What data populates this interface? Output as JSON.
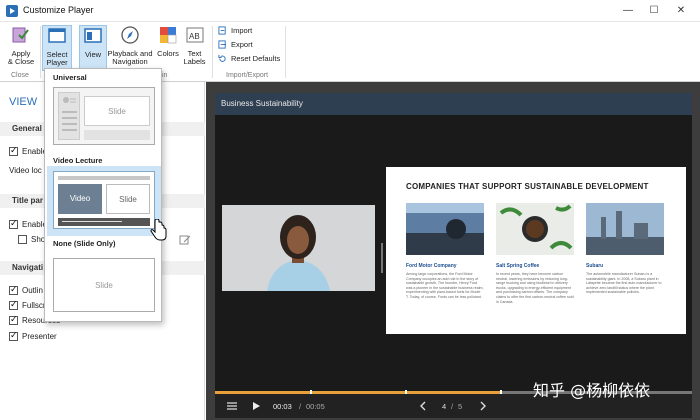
{
  "window": {
    "title": "Customize Player"
  },
  "ribbon": {
    "apply_close": "Apply\n& Close",
    "select_player": "Select\nPlayer",
    "view": "View",
    "playback_navigation": "Playback and\nNavigation",
    "colors": "Colors",
    "text_labels": "Text\nLabels",
    "import": "Import",
    "export": "Export",
    "reset_defaults": "Reset Defaults",
    "group_close": "Close",
    "group_import_export": "Import/Export",
    "group_partial": "in"
  },
  "leftpanel": {
    "view_title": "VIEW",
    "general": "General",
    "enable_partial": "Enable",
    "video_location_partial": "Video loc",
    "title_panel_partial": "Title par",
    "title_enable_partial": "Enable",
    "show_partial": "Sho",
    "navigation_partial": "Navigati",
    "outline_partial": "Outlin",
    "fullscreen_partial": "Fullscr",
    "resources": "Resources",
    "presenter": "Presenter"
  },
  "dropdown": {
    "universal": "Universal",
    "universal_slide": "Slide",
    "video_lecture": "Video Lecture",
    "lecture_video": "Video",
    "lecture_slide": "Slide",
    "none": "None (Slide Only)",
    "none_slide": "Slide"
  },
  "player": {
    "title": "Business Sustainability",
    "slide_title": "COMPANIES THAT SUPPORT SUSTAINABLE DEVELOPMENT",
    "columns": [
      {
        "title": "Ford Motor Company",
        "text": "Among large corporations, the Ford Motor Company occupies an add role in the story of sustainable growth. The founder, Henry Ford was a pioneer in the sustainable business realm, experimenting with plant-based fuels for Model T. Today, of course, Fords can be less pollutant."
      },
      {
        "title": "Salt Spring Coffee",
        "text": "In recent years, they have become carbon neutral, lowering emissions by reducing long-range trucking and using biodiesel in delivery trucks, upgrading to energy-efficient equipment and purchasing carbon offsets. The company claims to offer the first carbon-neutral coffee sold in Canada."
      },
      {
        "title": "Subaru",
        "text": "The automobile manufacturer Subaru is a sustainability giant. In 2008, a Subaru plant in Lafayette became the first auto manufacturer to achieve zero landfill status where the plant implemented sustainable policies."
      }
    ],
    "time_current": "00:03",
    "time_sep": "/",
    "time_total": "00:05",
    "page_current": "4",
    "page_sep": "/",
    "page_total": "5",
    "progress_fraction": 0.6
  },
  "watermark": "知乎 @杨柳依依",
  "colors": {
    "accent": "#2b6fb7",
    "timeline": "#e8a13a",
    "player_title_bg": "#2f3f52"
  }
}
